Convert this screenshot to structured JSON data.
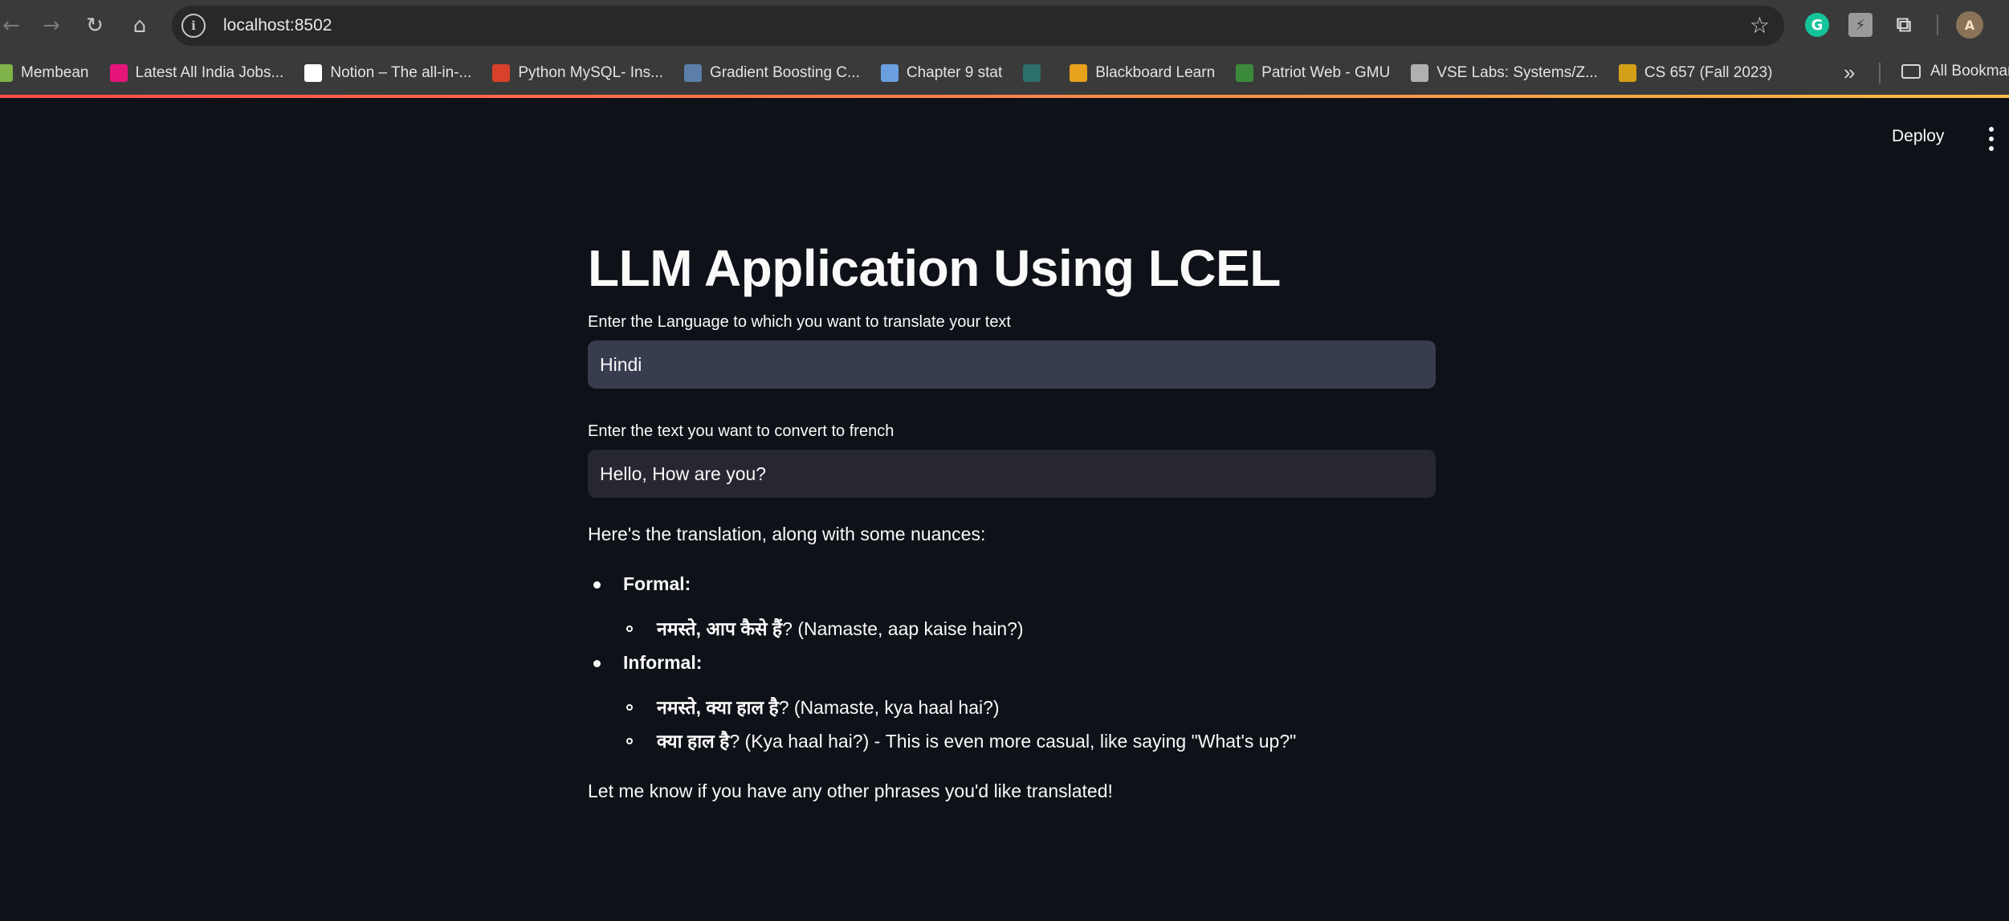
{
  "browser": {
    "url": "localhost:8502",
    "site_info_glyph": "i",
    "bookmarks": [
      {
        "label": "Membean",
        "icon_color": "#7fb24a"
      },
      {
        "label": "Latest All India Jobs...",
        "icon_color": "#e5157a"
      },
      {
        "label": "Notion – The all-in-...",
        "icon_color": "#ffffff"
      },
      {
        "label": "Python MySQL- Ins...",
        "icon_color": "#d9412b"
      },
      {
        "label": "Gradient Boosting C...",
        "icon_color": "#5b7fa8"
      },
      {
        "label": "Chapter 9 stat",
        "icon_color": "#6aa0e0"
      },
      {
        "label": "",
        "icon_color": "#2c6f6b"
      },
      {
        "label": "Blackboard Learn",
        "icon_color": "#e8a21c"
      },
      {
        "label": "Patriot Web - GMU",
        "icon_color": "#3b8a3b"
      },
      {
        "label": "VSE Labs: Systems/Z...",
        "icon_color": "#b0b0b0"
      },
      {
        "label": "CS 657 (Fall 2023)",
        "icon_color": "#d4a017"
      }
    ],
    "more_bookmarks_glyph": "»",
    "all_bookmarks_label": "All Bookmar",
    "extensions": {
      "grammarly": "G",
      "bolt": "⚡",
      "puzzle": "⧉",
      "avatar": "A"
    },
    "star_glyph": "☆",
    "nav": {
      "back": "←",
      "forward": "→",
      "reload": "↻",
      "home": "⌂"
    }
  },
  "app": {
    "deploy_label": "Deploy",
    "title": "LLM Application Using LCEL",
    "language_field": {
      "label": "Enter the Language to which you want to translate your text",
      "value": "Hindi"
    },
    "text_field": {
      "label": "Enter the text you want to convert to french",
      "value": "Hello, How are you?"
    },
    "output": {
      "intro": "Here's the translation, along with some nuances:",
      "formal": {
        "heading": "Formal:",
        "items": [
          {
            "hindi": "नमस्ते, आप कैसे हैं",
            "suffix": "? (Namaste, aap kaise hain?)"
          }
        ]
      },
      "informal": {
        "heading": "Informal:",
        "items": [
          {
            "hindi": "नमस्ते, क्या हाल है",
            "suffix": "? (Namaste, kya haal hai?)"
          },
          {
            "hindi": "क्या हाल है",
            "suffix": "? (Kya haal hai?) - This is even more casual, like saying \"What's up?\""
          }
        ]
      },
      "closing": "Let me know if you have any other phrases you'd like translated!"
    }
  }
}
